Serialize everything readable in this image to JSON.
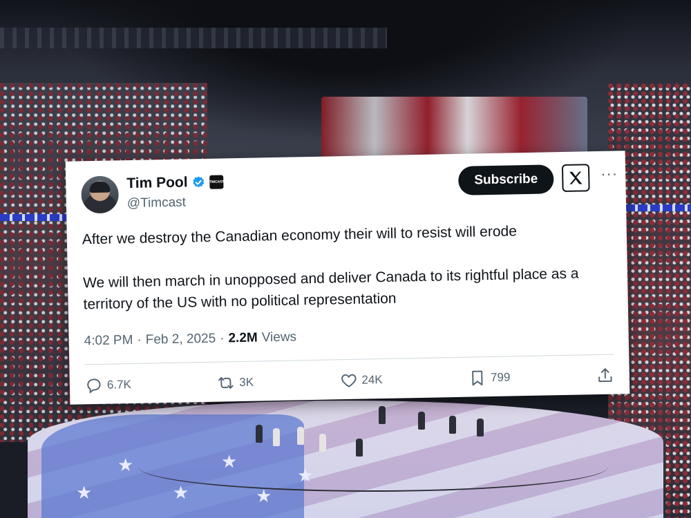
{
  "tweet": {
    "display_name": "Tim Pool",
    "handle": "@Timcast",
    "affiliation_badge_text": "TIMCAST",
    "subscribe_label": "Subscribe",
    "more_label": "···",
    "paragraphs": [
      "After we destroy the Canadian economy their will to resist will erode",
      "We will then march in unopposed and  deliver Canada to its rightful place as a territory of the US with no political representation"
    ],
    "time": "4:02 PM",
    "date": "Feb 2, 2025",
    "views_count": "2.2M",
    "views_label": "Views",
    "separator": "·",
    "actions": {
      "replies": "6.7K",
      "reposts": "3K",
      "likes": "24K",
      "bookmarks": "799"
    }
  },
  "icons": {
    "verified": "verified-badge-icon",
    "x_logo": "x-logo-icon",
    "reply": "reply-icon",
    "repost": "repost-icon",
    "like": "heart-icon",
    "bookmark": "bookmark-icon",
    "share": "share-icon"
  },
  "colors": {
    "verified_blue": "#1d9bf0",
    "text_primary": "#0f1419",
    "text_secondary": "#536471",
    "subscribe_bg": "#0f1419"
  }
}
